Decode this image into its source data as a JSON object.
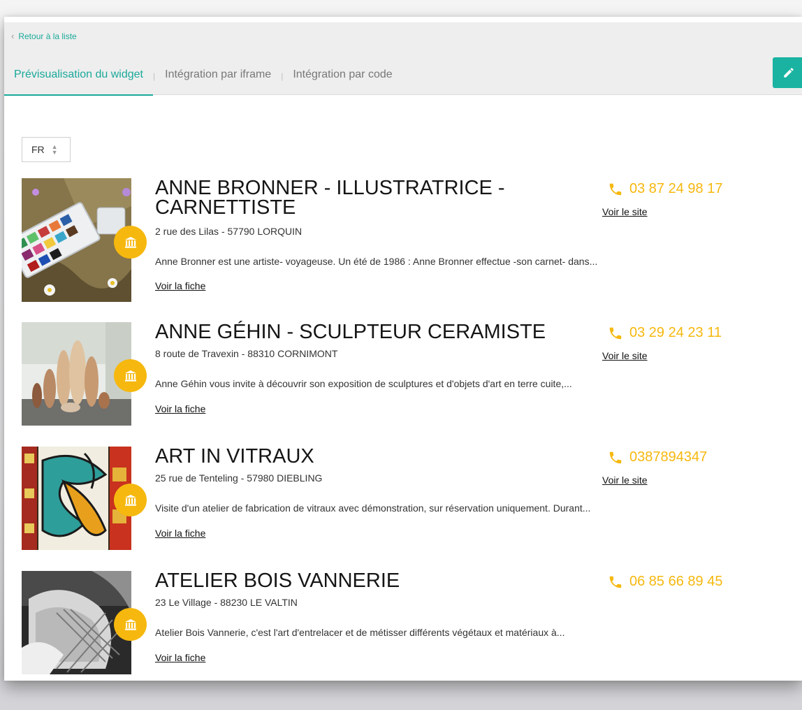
{
  "nav": {
    "back_label": "Retour à la liste"
  },
  "tabs": [
    {
      "label": "Prévisualisation du widget",
      "active": true
    },
    {
      "label": "Intégration par iframe",
      "active": false
    },
    {
      "label": "Intégration par code",
      "active": false
    }
  ],
  "tab_separator": "|",
  "language": {
    "selected": "FR"
  },
  "colors": {
    "accent": "#1aa99a",
    "badge": "#f6b80e",
    "phone": "#f6b80e"
  },
  "badge_icon": "museum-icon",
  "items": [
    {
      "title": "ANNE BRONNER - ILLUSTRATRICE - CARNETTISTE",
      "address": "2 rue des Lilas - 57790 LORQUIN",
      "description": "Anne Bronner est une artiste- voyageuse. Un été de 1986 : Anne Bronner effectue -son carnet- dans...",
      "phone": "03 87 24 98 17",
      "site_label": "Voir le site",
      "details_label": "Voir la fiche"
    },
    {
      "title": "ANNE GÉHIN - SCULPTEUR CERAMISTE",
      "address": "8 route de Travexin - 88310 CORNIMONT",
      "description": "Anne Géhin vous invite à découvrir son exposition de sculptures et d'objets d'art en terre cuite,...",
      "phone": "03 29 24 23 11",
      "site_label": "Voir le site",
      "details_label": "Voir la fiche"
    },
    {
      "title": "ART IN VITRAUX",
      "address": "25 rue de Tenteling - 57980 DIEBLING",
      "description": "Visite d'un atelier de fabrication de vitraux avec démonstration, sur réservation uniquement. Durant...",
      "phone": "0387894347",
      "site_label": "Voir le site",
      "details_label": "Voir la fiche"
    },
    {
      "title": "ATELIER BOIS VANNERIE",
      "address": "23 Le Village - 88230 LE VALTIN",
      "description": "Atelier Bois Vannerie, c'est l'art d'entrelacer et de métisser différents végétaux et matériaux à...",
      "phone": "06 85 66 89 45",
      "details_label": "Voir la fiche"
    }
  ]
}
